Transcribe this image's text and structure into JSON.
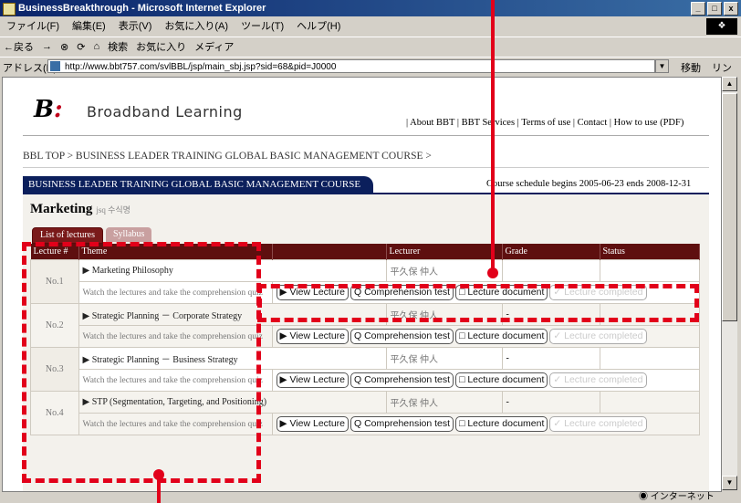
{
  "window": {
    "title": "BusinessBreakthrough - Microsoft Internet Explorer",
    "buttons": [
      "_",
      "□",
      "x"
    ]
  },
  "menu": [
    "ファイル(F)",
    "編集(E)",
    "表示(V)",
    "お気に入り(A)",
    "ツール(T)",
    "ヘルプ(H)"
  ],
  "toolbar": {
    "back": "←戻る",
    "items": [
      "→",
      "⊗",
      "⟳",
      "⌂",
      "検索",
      "お気に入り",
      "メディア"
    ]
  },
  "address": {
    "label": "アドレス(D)",
    "url": "http://www.bbt757.com/svlBBL/jsp/main_sbj.jsp?sid=68&pid=J0000",
    "go": "移動",
    "links": "リンク »"
  },
  "site": {
    "logo": "B",
    "brand": "Broadband Learning",
    "links": "| About BBT | BBT Services | Terms of use | Contact | How to use (PDF)"
  },
  "breadcrumb": "BBL TOP > BUSINESS LEADER TRAINING GLOBAL BASIC MANAGEMENT COURSE >",
  "course": {
    "tab": "BUSINESS LEADER TRAINING GLOBAL BASIC MANAGEMENT COURSE",
    "schedule": "Course schedule begins 2005-06-23 ends 2008-12-31"
  },
  "section": {
    "title": "Marketing",
    "subtitle": "jsq 수식명",
    "tabs": [
      "List of lectures",
      "Syllabus"
    ]
  },
  "table": {
    "headers": [
      "Lecture #",
      "Theme",
      "",
      "Lecturer",
      "Grade",
      "Status"
    ],
    "note": "Watch the lectures and take the comprehension quiz",
    "buttons": [
      "▶ View Lecture",
      "Q Comprehension test",
      "□ Lecture document",
      "✓ Lecture completed"
    ],
    "rows": [
      {
        "no": "No.1",
        "theme": "▶ Marketing Philosophy",
        "lecturer": "平久保 仲人",
        "grade": ""
      },
      {
        "no": "No.2",
        "theme": "▶ Strategic Planning － Corporate Strategy",
        "lecturer": "平久保 仲人",
        "grade": "-"
      },
      {
        "no": "No.3",
        "theme": "▶ Strategic Planning － Business Strategy",
        "lecturer": "平久保 仲人",
        "grade": "-"
      },
      {
        "no": "No.4",
        "theme": "▶ STP (Segmentation, Targeting, and Positioning)",
        "lecturer": "平久保 仲人",
        "grade": "-"
      }
    ]
  },
  "status": {
    "zone": "インターネット"
  },
  "annotation_color": "#e2001a"
}
